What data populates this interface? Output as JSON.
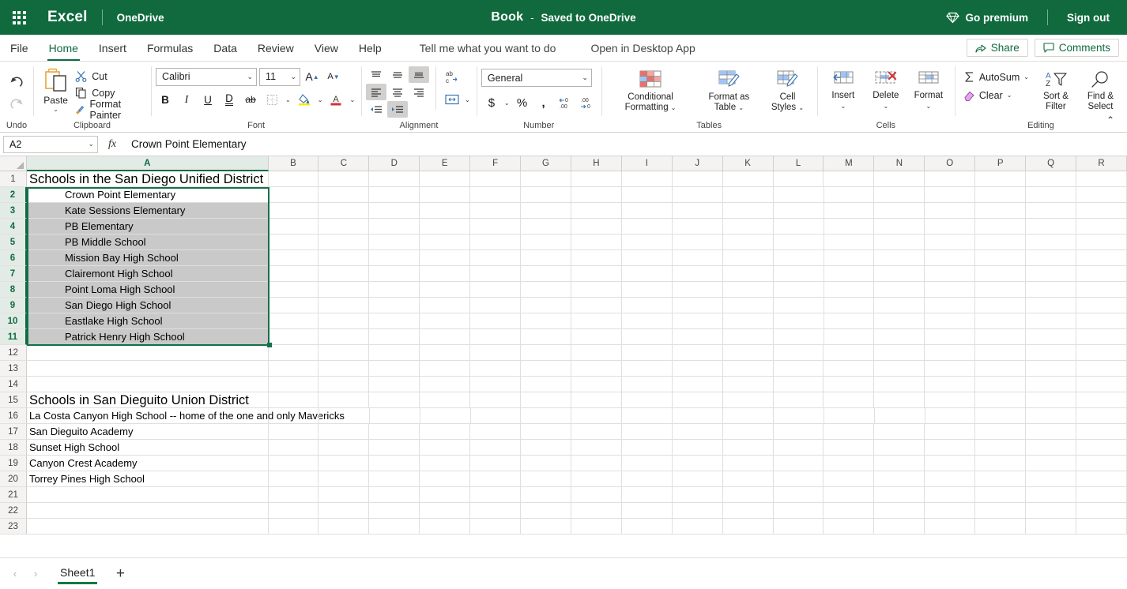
{
  "titlebar": {
    "app_name": "Excel",
    "storage_location": "OneDrive",
    "doc_title": "Book",
    "doc_dash": "-",
    "save_status": "Saved to OneDrive",
    "go_premium": "Go premium",
    "sign_out": "Sign out",
    "brand_color": "#106a3e"
  },
  "tabs": [
    {
      "label": "File",
      "active": false
    },
    {
      "label": "Home",
      "active": true
    },
    {
      "label": "Insert",
      "active": false
    },
    {
      "label": "Formulas",
      "active": false
    },
    {
      "label": "Data",
      "active": false
    },
    {
      "label": "Review",
      "active": false
    },
    {
      "label": "View",
      "active": false
    },
    {
      "label": "Help",
      "active": false
    }
  ],
  "tabstrip_extra": {
    "tell_me": "Tell me what you want to do",
    "open_in_desktop": "Open in Desktop App",
    "share": "Share",
    "comments": "Comments"
  },
  "ribbon": {
    "groups": {
      "undo": {
        "label": "Undo",
        "undo_tooltip": "Undo",
        "redo_tooltip": "Redo"
      },
      "clipboard": {
        "label": "Clipboard",
        "paste": "Paste",
        "cut": "Cut",
        "copy": "Copy",
        "format_painter": "Format Painter"
      },
      "font": {
        "label": "Font",
        "font_name": "Calibri",
        "font_size": "11",
        "grow_font": "A",
        "shrink_font": "A",
        "bold": "B",
        "italic": "I",
        "underline": "U",
        "double_underline": "D",
        "strikethrough": "ab",
        "borders": "Borders",
        "fill_color": "Fill Color",
        "font_color": "Font Color"
      },
      "alignment": {
        "label": "Alignment",
        "top_align": "Top Align",
        "middle_align": "Middle Align",
        "bottom_align": "Bottom Align",
        "align_left": "Align Left",
        "center": "Center",
        "align_right": "Align Right",
        "decrease_indent": "Decrease Indent",
        "increase_indent": "Increase Indent",
        "wrap_text": "Wrap Text",
        "merge_cells": "Merge & Center"
      },
      "number": {
        "label": "Number",
        "format": "General",
        "accounting": "$",
        "percent": "%",
        "comma": ",",
        "increase_decimal": "Increase Decimal",
        "decrease_decimal": "Decrease Decimal"
      },
      "tables": {
        "label": "Tables",
        "conditional_formatting": "Conditional Formatting",
        "format_as_table": "Format as Table",
        "cell_styles": "Cell Styles"
      },
      "cells": {
        "label": "Cells",
        "insert": "Insert",
        "delete": "Delete",
        "format": "Format"
      },
      "editing": {
        "label": "Editing",
        "autosum": "AutoSum",
        "clear": "Clear",
        "sort_filter": "Sort & Filter",
        "find_select": "Find & Select"
      }
    }
  },
  "formulabar": {
    "name_box": "A2",
    "fx": "fx",
    "formula_value": "Crown Point Elementary"
  },
  "grid": {
    "columns": [
      "A",
      "B",
      "C",
      "D",
      "E",
      "F",
      "G",
      "H",
      "I",
      "J",
      "K",
      "L",
      "M",
      "N",
      "O",
      "P",
      "Q",
      "R"
    ],
    "selected_column": "A",
    "active_cell": "A2",
    "selection_range": "A2:A11",
    "rows": [
      {
        "num": "1",
        "value": "Schools in the San Diego Unified District",
        "style": "title",
        "selected": false
      },
      {
        "num": "2",
        "value": "Crown Point Elementary",
        "style": "indent",
        "selected": false
      },
      {
        "num": "3",
        "value": "Kate Sessions Elementary",
        "style": "indent",
        "selected": true
      },
      {
        "num": "4",
        "value": "PB Elementary",
        "style": "indent",
        "selected": true
      },
      {
        "num": "5",
        "value": "PB Middle School",
        "style": "indent",
        "selected": true
      },
      {
        "num": "6",
        "value": "Mission Bay High School",
        "style": "indent",
        "selected": true
      },
      {
        "num": "7",
        "value": "Clairemont High School",
        "style": "indent",
        "selected": true
      },
      {
        "num": "8",
        "value": "Point Loma High School",
        "style": "indent",
        "selected": true
      },
      {
        "num": "9",
        "value": "San Diego High School",
        "style": "indent",
        "selected": true
      },
      {
        "num": "10",
        "value": "Eastlake High School",
        "style": "indent",
        "selected": true
      },
      {
        "num": "11",
        "value": "Patrick Henry High School",
        "style": "indent",
        "selected": true
      },
      {
        "num": "12",
        "value": "",
        "style": "normal",
        "selected": false
      },
      {
        "num": "13",
        "value": "",
        "style": "normal",
        "selected": false
      },
      {
        "num": "14",
        "value": "",
        "style": "normal",
        "selected": false
      },
      {
        "num": "15",
        "value": "Schools in San Dieguito Union District",
        "style": "title",
        "selected": false
      },
      {
        "num": "16",
        "value": "La Costa Canyon High School -- home of the one and only Mavericks",
        "style": "normal",
        "selected": false
      },
      {
        "num": "17",
        "value": "San Dieguito Academy",
        "style": "normal",
        "selected": false
      },
      {
        "num": "18",
        "value": "Sunset High School",
        "style": "normal",
        "selected": false
      },
      {
        "num": "19",
        "value": "Canyon Crest Academy",
        "style": "normal",
        "selected": false
      },
      {
        "num": "20",
        "value": "Torrey Pines High School",
        "style": "normal",
        "selected": false
      },
      {
        "num": "21",
        "value": "",
        "style": "normal",
        "selected": false
      },
      {
        "num": "22",
        "value": "",
        "style": "normal",
        "selected": false
      },
      {
        "num": "23",
        "value": "",
        "style": "normal",
        "selected": false
      }
    ]
  },
  "sheetbar": {
    "prev_label": "Previous sheet",
    "next_label": "Next sheet",
    "sheet_name": "Sheet1",
    "add_sheet": "+"
  }
}
